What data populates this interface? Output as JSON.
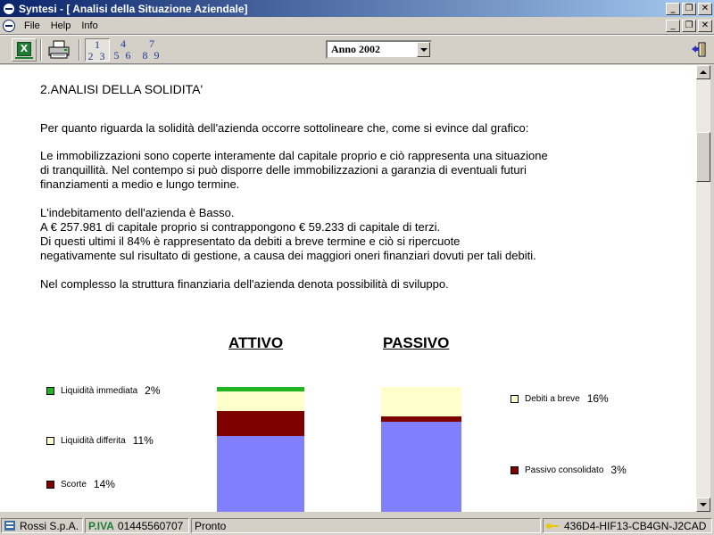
{
  "window": {
    "title": "Syntesi - [ Analisi della Situazione Aziendale]"
  },
  "menu": {
    "items": [
      "File",
      "Help",
      "Info"
    ]
  },
  "toolbar": {
    "page_groups": [
      {
        "top": "1",
        "bottom": "2 3"
      },
      {
        "top": "4",
        "bottom": "5 6"
      },
      {
        "top": "7",
        "bottom": "8 9"
      }
    ],
    "year_select": {
      "value": "Anno 2002"
    }
  },
  "content": {
    "heading": "2.ANALISI DELLA SOLIDITA'",
    "paragraphs": [
      [
        "Per quanto riguarda la solidità dell'azienda occorre sottolineare che, come si evince dal grafico:"
      ],
      [
        "Le immobilizzazioni sono coperte interamente dal capitale proprio e ciò rappresenta una situazione",
        "di tranquillità. Nel contempo si può disporre delle immobilizzazioni a garanzia di eventuali futuri",
        "finanziamenti a medio e lungo termine."
      ],
      [
        "L'indebitamento dell'azienda è Basso.",
        "A € 257.981 di capitale proprio si contrappongono € 59.233 di capitale di terzi.",
        "Di questi ultimi il 84% è rappresentato da debiti a breve termine e ciò si ripercuote",
        "negativamente sul risultato di gestione, a causa dei maggiori oneri finanziari dovuti per tali debiti."
      ],
      [
        "Nel complesso la struttura finanziaria dell'azienda denota possibilità di sviluppo."
      ]
    ]
  },
  "chart": {
    "attivo_title": "ATTIVO",
    "passivo_title": "PASSIVO",
    "attivo_legend": [
      {
        "label": "Liquidità immediata",
        "pct": "2%",
        "color": "#22b522"
      },
      {
        "label": "Liquidità differita",
        "pct": "11%",
        "color": "#ffffcc"
      },
      {
        "label": "Scorte",
        "pct": "14%",
        "color": "#800000"
      }
    ],
    "passivo_legend": [
      {
        "label": "Debiti a breve",
        "pct": "16%",
        "color": "#ffffcc"
      },
      {
        "label": "Passivo consolidato",
        "pct": "3%",
        "color": "#800000"
      }
    ],
    "immobilizzazioni_color": "#8080ff",
    "capitale_proprio_color": "#8080ff"
  },
  "status": {
    "company": "Rossi S.p.A.",
    "piva_label": "P.IVA",
    "piva_value": "01445560707",
    "state": "Pronto",
    "license_key": "436D4-HIF13-CB4GN-J2CAD"
  }
}
